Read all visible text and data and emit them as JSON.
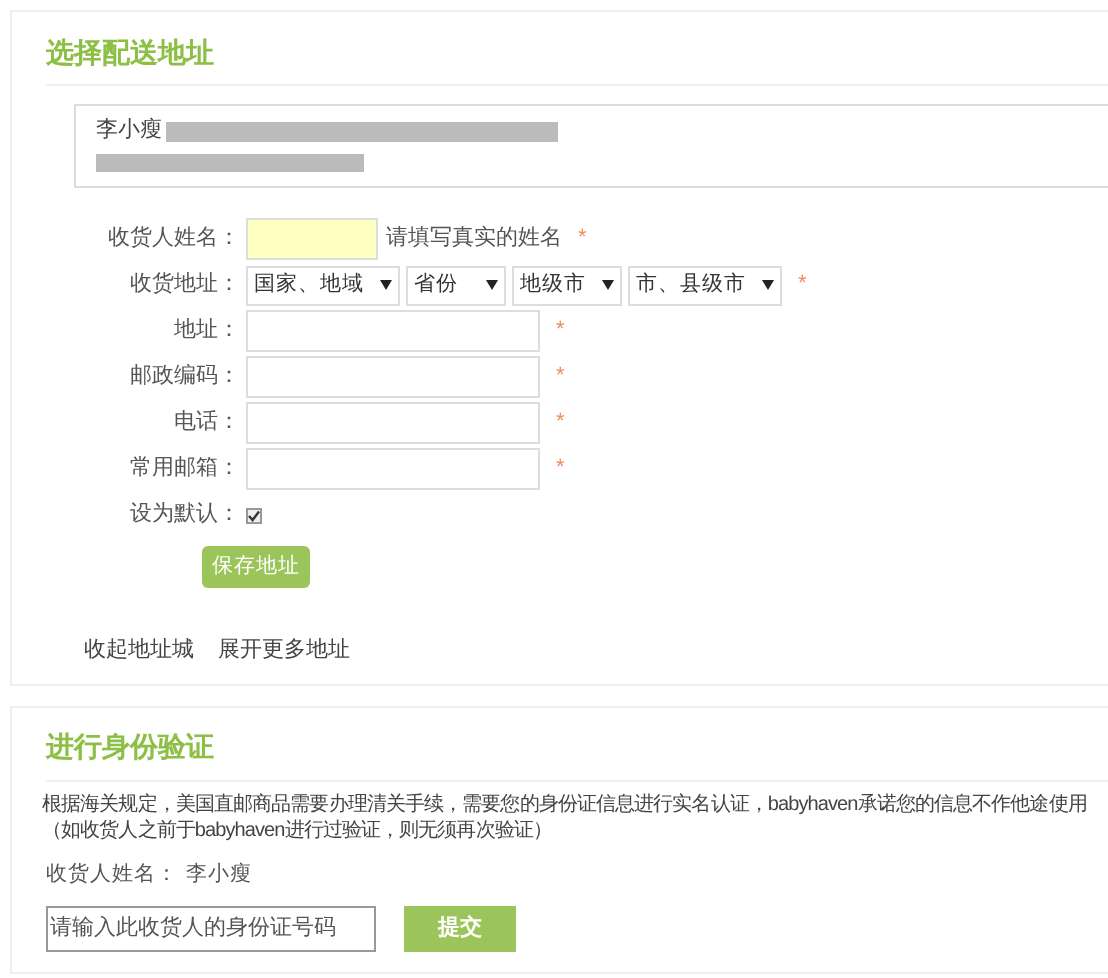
{
  "address_section": {
    "title": "选择配送地址",
    "saved_address": {
      "name": "李小瘦"
    },
    "form": {
      "rows": [
        {
          "kind": "text",
          "label": "收货人姓名：",
          "highlighted": true,
          "hint": "请填写真实的姓名",
          "required": "*",
          "wide": false
        },
        {
          "kind": "selects",
          "label": "收货地址：",
          "selects": [
            "国家、地域",
            "省份",
            "地级市",
            "市、县级市"
          ],
          "required": "*"
        },
        {
          "kind": "text",
          "label": "地址：",
          "highlighted": false,
          "required": "*",
          "wide": true
        },
        {
          "kind": "text",
          "label": "邮政编码：",
          "highlighted": false,
          "required": "*",
          "wide": true
        },
        {
          "kind": "text",
          "label": "电话：",
          "highlighted": false,
          "required": "*",
          "wide": true
        },
        {
          "kind": "text",
          "label": "常用邮箱：",
          "highlighted": false,
          "required": "*",
          "wide": true
        },
        {
          "kind": "checkbox",
          "label": "设为默认：",
          "checked": true
        }
      ],
      "save_button": "保存地址"
    },
    "links": [
      "收起地址城",
      "展开更多地址"
    ]
  },
  "id_section": {
    "title": "进行身份验证",
    "notice": [
      "根据海关规定，美国直邮商品需要办理清关手续，需要您的身份证信息进行实名认证，babyhaven承诺您的信息不作他途使用",
      "（如收货人之前于babyhaven进行过验证，则无须再次验证）"
    ],
    "recipient_label": "收货人姓名：",
    "recipient_name": "李小瘦",
    "id_placeholder": "请输入此收货人的身份证号码",
    "submit_button": "提交"
  }
}
